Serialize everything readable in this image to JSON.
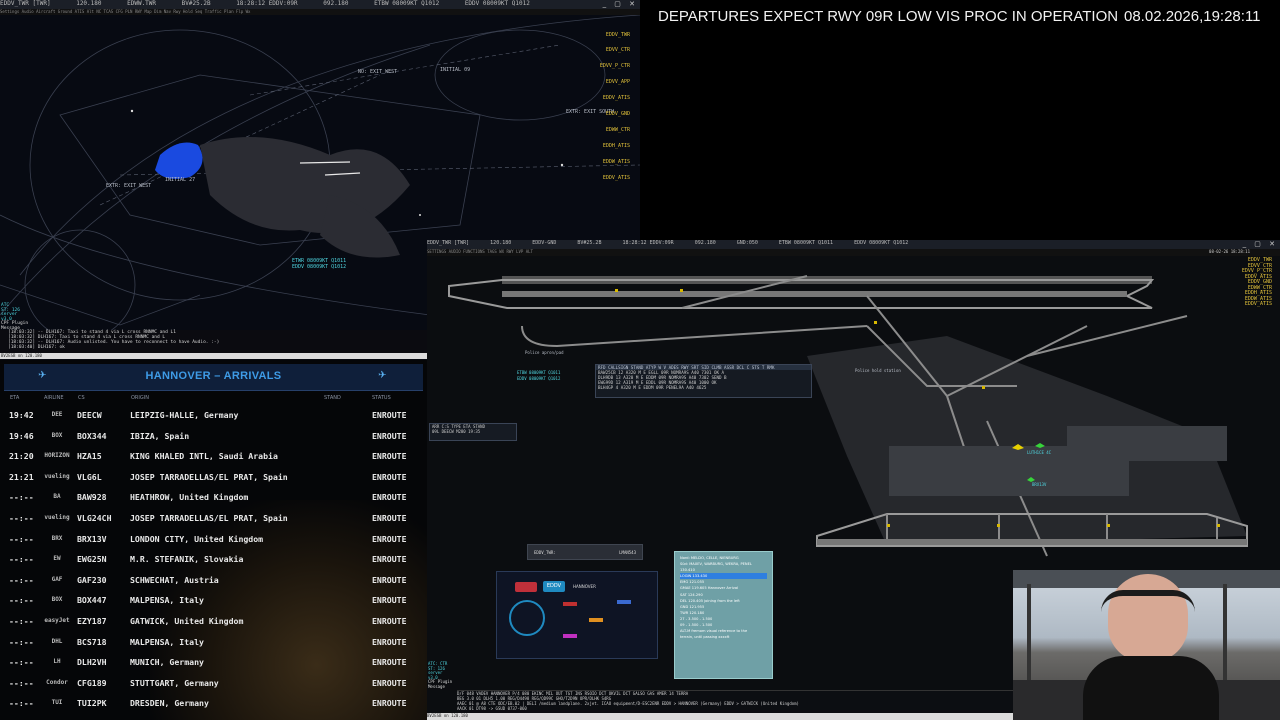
{
  "radar": {
    "titlebar": [
      "EDDV_TWR [TWR]",
      "120.180",
      "EDWW.TWR",
      "BV#25.2B",
      "18:28:12 EDDV:09R",
      "092.180",
      "ETBW 08009KT Q1012",
      "EDDV 08009KT Q1012"
    ],
    "subbar": "Settings  Audio  Aircraft  Ground  ATIS  Alt  NC  TCAS  CFG  PLN  RWY  Map  Dim  Nav  Rwy  Hold  Seq  Traffic  Plan  Flp  Wx",
    "window_buttons": "_ ▢ ✕",
    "map_labels": [
      "NO: EXIT WEST",
      "INITIAL 09",
      "EXTR: EXIT SOUTH",
      "EXTR: EXIT WEST",
      "INITIAL 27",
      "ETWR 08009KT Q1011",
      "EDDV 08009KT Q1012"
    ],
    "side_list": [
      "EDDV_TWR",
      "EDVV_CTR",
      "EDVV_P_CTR",
      "EDVV_APP",
      "EDDV_ATIS",
      "EDDV_GND",
      "EDWW_CTR",
      "EDDH_ATIS",
      "EDDW_ATIS",
      "EDDV_ATIS"
    ],
    "left_tags": [
      "ATC",
      "ST: 126",
      "server",
      "v3.0",
      "CPF Plugin",
      "Message"
    ],
    "chat": [
      "[18:03:32] -- DLH167: Taxi to stand 4 via L cross RNNMC and L1",
      "[18:03:32] DLH167: Taxi to stand 4 via L cross RNNMC and L",
      "[18:03:32] -- DLH167: Audio unlisted. You have to reconnect to have Audio. :-)",
      "[18:03:40] DLH167: ok"
    ],
    "status": "BV2ESB on 120.180"
  },
  "banner": {
    "text": "DEPARTURES EXPECT RWY 09R LOW VIS PROC IN OPERATION",
    "datetime": "08.02.2026,19:28:11"
  },
  "arrivals": {
    "title": "HANNOVER – ARRIVALS",
    "columns": {
      "eta": "ETA",
      "airline": "AIRLINE",
      "cs": "CS",
      "origin": "ORIGIN",
      "stand": "STAND",
      "status": "STATUS"
    },
    "rows": [
      {
        "eta": "19:42",
        "airline": "DEE",
        "cs": "DEECW",
        "origin": "LEIPZIG-HALLE, Germany",
        "status": "ENROUTE"
      },
      {
        "eta": "19:46",
        "airline": "BOX",
        "cs": "BOX344",
        "origin": "IBIZA, Spain",
        "status": "ENROUTE"
      },
      {
        "eta": "21:20",
        "airline": "HORIZON",
        "cs": "HZA15",
        "origin": "KING KHALED INTL, Saudi Arabia",
        "status": "ENROUTE"
      },
      {
        "eta": "21:21",
        "airline": "vueling",
        "cs": "VLG6L",
        "origin": "JOSEP TARRADELLAS/EL PRAT, Spain",
        "status": "ENROUTE"
      },
      {
        "eta": "--:--",
        "airline": "BA",
        "cs": "BAW928",
        "origin": "HEATHROW, United Kingdom",
        "status": "ENROUTE"
      },
      {
        "eta": "--:--",
        "airline": "vueling",
        "cs": "VLG24CH",
        "origin": "JOSEP TARRADELLAS/EL PRAT, Spain",
        "status": "ENROUTE"
      },
      {
        "eta": "--:--",
        "airline": "BRX",
        "cs": "BRX13V",
        "origin": "LONDON CITY, United Kingdom",
        "status": "ENROUTE"
      },
      {
        "eta": "--:--",
        "airline": "EW",
        "cs": "EWG25N",
        "origin": "M.R. STEFANIK, Slovakia",
        "status": "ENROUTE"
      },
      {
        "eta": "--:--",
        "airline": "GAF",
        "cs": "GAF230",
        "origin": "SCHWECHAT, Austria",
        "status": "ENROUTE"
      },
      {
        "eta": "--:--",
        "airline": "BOX",
        "cs": "BOX447",
        "origin": "MALPENSA, Italy",
        "status": "ENROUTE"
      },
      {
        "eta": "--:--",
        "airline": "easyJet",
        "cs": "EZY187",
        "origin": "GATWICK, United Kingdom",
        "status": "ENROUTE"
      },
      {
        "eta": "--:--",
        "airline": "DHL",
        "cs": "BCS718",
        "origin": "MALPENSA, Italy",
        "status": "ENROUTE"
      },
      {
        "eta": "--:--",
        "airline": "LH",
        "cs": "DLH2VH",
        "origin": "MUNICH, Germany",
        "status": "ENROUTE"
      },
      {
        "eta": "--:--",
        "airline": "Condor",
        "cs": "CFG189",
        "origin": "STUTTGART, Germany",
        "status": "ENROUTE"
      },
      {
        "eta": "--:--",
        "airline": "TUI",
        "cs": "TUI2PK",
        "origin": "DRESDEN, Germany",
        "status": "ENROUTE"
      }
    ]
  },
  "ground": {
    "titlebar": [
      "EDDV_TWR [TWR]",
      "120.180",
      "EDDV-GND",
      "BV#25.2B",
      "18:28:12 EDDV:09R",
      "092.180",
      "GND:050",
      "ETBW 08009KT Q1011",
      "EDDV 08009KT Q1012"
    ],
    "subbar": "SETTINGS  AUDIO  FUNCTIONS  TAGS  WX  RWY  LVP  ALT",
    "datetime_small": "08-02-26 18:28:11",
    "labels": [
      "Police apron/pad",
      "Police hold station",
      "ETBW 08009KT Q1011",
      "EDDV 08009KT Q1012"
    ],
    "side_list": [
      "EDDV_TWR",
      "EDVV_CTR",
      "EDVV_P_CTR",
      "EDDV_ATIS",
      "EDDV_GND",
      "EDWW_CTR",
      "EDDH_ATIS",
      "EDDW_ATIS",
      "EDDV_ATIS"
    ],
    "flightlist": {
      "header": "RFD CALLSIGN  STAND  ATYP  W  V  ADES  RWY  SRT  SID    CLMB  ASSR  DCL  C  STS  T  RMK",
      "rows": [
        "BAW25CB   12  A320  M  E  EGLL  09R       NOMRA9S  A40  7301  OK  A",
        "DLH9DB    13  A320  M  E  EDDM  09R       NOMRA9S  A40  7302  SEND  B",
        "EWG99D    12  A319  M  E  EDDL  09R       NOMRA9S  A40  1000  OK",
        "BLH4GP     4  A320  M  E  EDDM  09R       PENEL9A  A40  4625"
      ]
    },
    "mini_panel": [
      "ARR  C:S  TYPE  ETA  STAND",
      "09L  DEECW  M280  19:35"
    ],
    "station": {
      "left": "EDDV_TWR:",
      "right": "LMAN543"
    },
    "vaccs": {
      "brand": "EDDV",
      "tab": "HANNOVER"
    },
    "infocard": [
      "Nord: MELDO, CELLE, NIENBURG",
      "Süd: MAXEV, WARBURG, WEKRA, PENEL",
      "130.410",
      "LOGIN 133.430",
      "EMG 121.055",
      "GMAE 119.605 Hannover Arrival",
      "SAT 124.290",
      "DEL 120.405 joining from the left",
      "GND 121.955",
      "TWR 120.180",
      "27 - 3.500 - 1.500",
      "09 - 1.500 - 1.500",
      "ALT-M fremom visual reference to the",
      "terrain, until passing xxxxft"
    ],
    "bottom_log": [
      "ATC: CTR",
      "ST: 126",
      "server",
      "v3.0",
      "CPF Plugin",
      "Message"
    ],
    "bottom_strip": [
      "D/F   048      VADEV   HANNOVER  P/4   080 EKINC MIL OUT TGT INS RSOIO DCT OKVIL DCT GALSO GAS AMER 14 TERRA",
      "BEG 3.0  01 DLH5 1.00    REG/D4498 REG/QD99C GHO/T2D9N OPR/DLHK S4RG",
      "AAEC 01  @ A8 CTE ODC/EB.02 | DELI /medium landplane. 2xjet. ICAO equipment/D-ESC2ENR EDDV > HANNOVER (Germany) EDDV > GATWICK (United Kingdom)",
      "AACK 01  DT98 -> GSUD 0737-060"
    ],
    "status": "BV2ESB on 120.180"
  }
}
